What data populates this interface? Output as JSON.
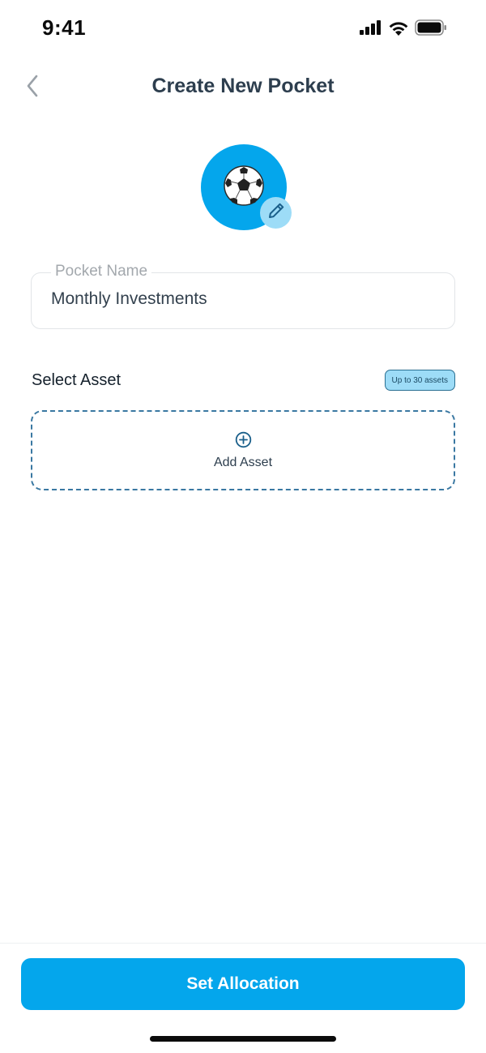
{
  "status_bar": {
    "time": "9:41",
    "icons": [
      "cellular-signal-icon",
      "wifi-icon",
      "battery-icon"
    ]
  },
  "header": {
    "back_icon": "chevron-left-icon",
    "title": "Create New Pocket"
  },
  "avatar": {
    "emoji": "⚽",
    "edit_icon": "pencil-icon",
    "background_color": "#04a6ec",
    "edit_badge_color": "#9ddcf7"
  },
  "pocket_name": {
    "label": "Pocket Name",
    "value": "Monthly Investments"
  },
  "select_asset": {
    "title": "Select Asset",
    "limit_badge": "Up to 30 assets",
    "add_icon": "plus-circle-icon",
    "add_label": "Add Asset"
  },
  "footer": {
    "primary_button": "Set Allocation",
    "accent_color": "#04a6ec"
  }
}
